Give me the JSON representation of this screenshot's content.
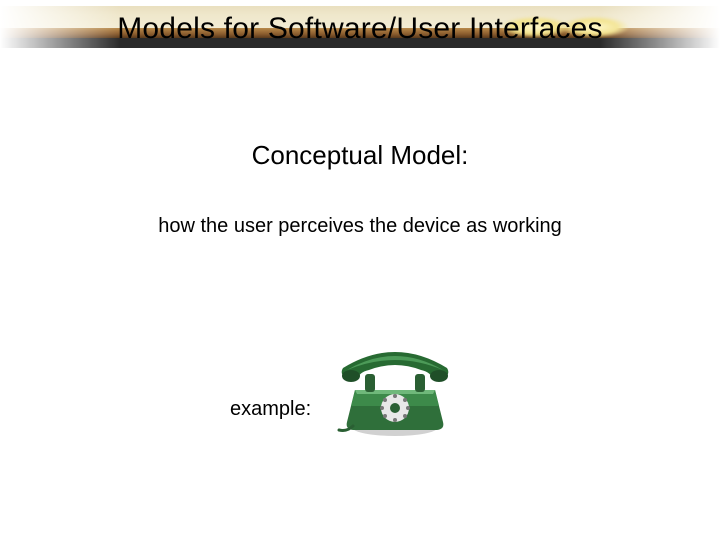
{
  "slide": {
    "title": "Models for Software/User Interfaces",
    "subtitle": "Conceptual Model:",
    "body": "how the user perceives the device as working",
    "example_label": "example:",
    "image_alt": "telephone-icon"
  }
}
